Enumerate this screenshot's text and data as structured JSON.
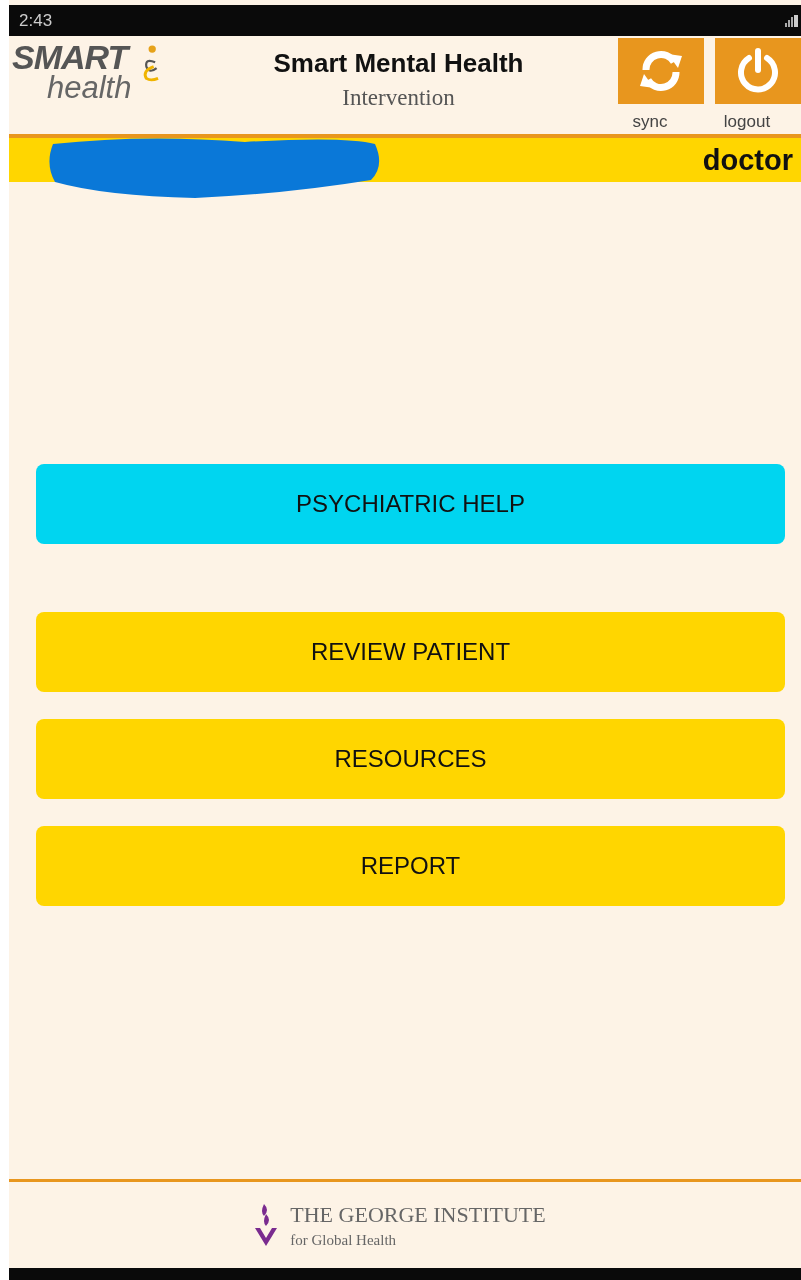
{
  "status_bar": {
    "time": "2:43"
  },
  "header": {
    "logo": {
      "word_1": "SMART",
      "word_2": "health"
    },
    "title": "Smart Mental Health",
    "subtitle": "Intervention",
    "actions": [
      {
        "kind": "sync",
        "label": "sync"
      },
      {
        "kind": "logout",
        "label": "logout"
      }
    ]
  },
  "user_bar": {
    "role": "doctor"
  },
  "menu": [
    {
      "kind": "highlight",
      "label": "PSYCHIATRIC HELP"
    },
    {
      "kind": "standard",
      "label": "REVIEW PATIENT"
    },
    {
      "kind": "standard",
      "label": "RESOURCES"
    },
    {
      "kind": "standard",
      "label": "REPORT"
    }
  ],
  "footer": {
    "org_name": "THE GEORGE INSTITUTE",
    "org_subtitle": "for Global Health"
  }
}
